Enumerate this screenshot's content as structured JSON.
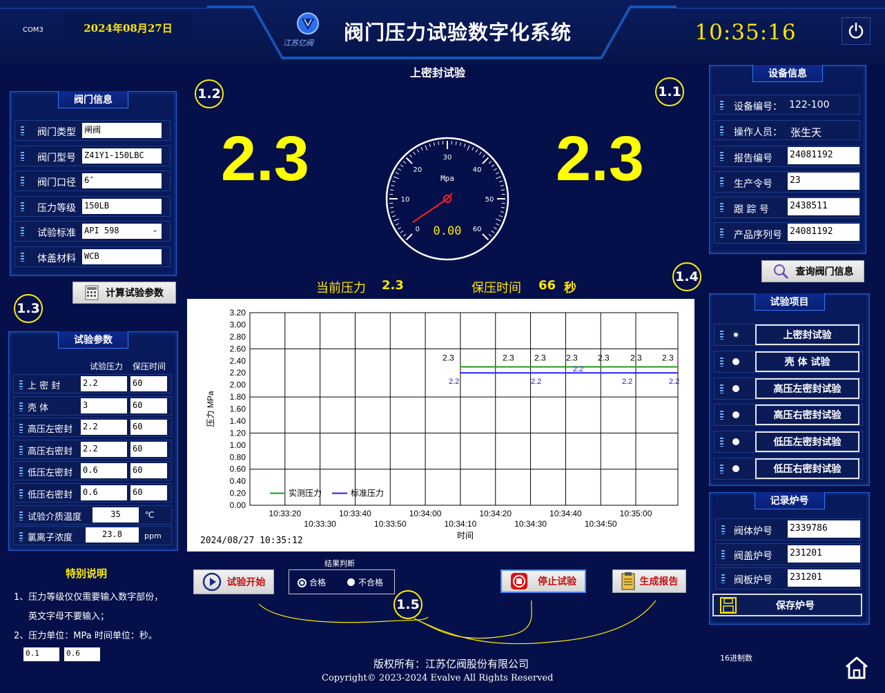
{
  "header": {
    "com_port": "COM3",
    "date": "2024年08月27日",
    "app_title": "阀门压力试验数字化系统",
    "logo_text": "江苏亿阀",
    "time": "10:35:16"
  },
  "test_title": "上密封试验",
  "valve_info": {
    "title": "阀门信息",
    "fields": [
      {
        "label": "阀门类型",
        "value": "闸阀"
      },
      {
        "label": "阀门型号",
        "value": "Z41Y1-150LBC"
      },
      {
        "label": "阀门口径",
        "value": "6″"
      },
      {
        "label": "压力等级",
        "value": "150LB"
      },
      {
        "label": "试验标准",
        "value": "API 598"
      },
      {
        "label": "体盖材料",
        "value": "WCB"
      }
    ],
    "calc_button": "计算试验参数"
  },
  "test_params": {
    "title": "试验参数",
    "col_pressure": "试验压力",
    "col_hold": "保压时间",
    "rows": [
      {
        "label": "上 密 封",
        "pressure": "2.2",
        "hold": "60"
      },
      {
        "label": "壳  体",
        "pressure": "3",
        "hold": "60"
      },
      {
        "label": "高压左密封",
        "pressure": "2.2",
        "hold": "60"
      },
      {
        "label": "高压右密封",
        "pressure": "2.2",
        "hold": "60"
      },
      {
        "label": "低压左密封",
        "pressure": "0.6",
        "hold": "60"
      },
      {
        "label": "低压右密封",
        "pressure": "0.6",
        "hold": "60"
      }
    ],
    "temp_label": "试验介质温度",
    "temp_value": "35",
    "temp_unit": "℃",
    "chloride_label": "氯离子浓度",
    "chloride_value": "23.8",
    "chloride_unit": "ppm"
  },
  "notes": {
    "title": "特别说明",
    "line1": "1、压力等级仅仅需要输入数字部份，",
    "line2": "英文字母不要输入；",
    "line3": "2、压力单位：MPa 时间单位：秒。",
    "box1": "0.1",
    "box2": "0.6"
  },
  "markers": {
    "m11": "1.1",
    "m12": "1.2",
    "m13": "1.3",
    "m14": "1.4",
    "m15": "1.5"
  },
  "readings": {
    "left_value": "2.3",
    "right_value": "2.3",
    "gauge_unit": "Mpa",
    "gauge_readout": "0.00",
    "gauge_ticks": [
      "0",
      "10",
      "20",
      "30",
      "40",
      "50",
      "60"
    ],
    "current_label": "当前压力",
    "current_value": "2.3",
    "hold_label": "保压时间",
    "hold_value": "66",
    "hold_unit": "秒"
  },
  "chart_data": {
    "type": "line",
    "ylabel": "压力 MPa",
    "xlabel": "时间",
    "ylim": [
      0,
      3.2
    ],
    "yticks": [
      "0.00",
      "0.20",
      "0.40",
      "0.60",
      "0.80",
      "1.00",
      "1.20",
      "1.40",
      "1.60",
      "1.80",
      "2.00",
      "2.20",
      "2.40",
      "2.60",
      "2.80",
      "3.00",
      "3.20"
    ],
    "xticks_upper": [
      "10:33:20",
      "10:33:40",
      "10:34:00",
      "10:34:20",
      "10:34:40",
      "10:35:00"
    ],
    "xticks_lower": [
      "10:33:30",
      "10:33:50",
      "10:34:10",
      "10:34:30",
      "10:34:50"
    ],
    "series": [
      {
        "name": "实测压力",
        "color": "#1a9a1a",
        "x_start": "10:34:10",
        "x_end": "10:35:12",
        "y": 2.3
      },
      {
        "name": "标准压力",
        "color": "#2020ff",
        "x_start": "10:34:10",
        "x_end": "10:35:12",
        "y": 2.2
      }
    ],
    "labels_actual": [
      "2.3",
      "2.3",
      "2.3",
      "2.3",
      "2.3",
      "2.3",
      "2.3"
    ],
    "labels_std": [
      "2.2",
      "2.2",
      "2.2",
      "2.2",
      "2.2"
    ],
    "timestamp": "2024/08/27 10:35:12",
    "grid": true,
    "legend": "bottom-left"
  },
  "controls": {
    "start_button": "试验开始",
    "result_title": "结果判断",
    "pass_label": "合格",
    "fail_label": "不合格",
    "stop_button": "停止试验",
    "report_button": "生成报告"
  },
  "device_info": {
    "title": "设备信息",
    "device_no_label": "设备编号：",
    "device_no": "122-100",
    "operator_label": "操作人员：",
    "operator": "张生天",
    "fields": [
      {
        "label": "报告编号",
        "value": "24081192"
      },
      {
        "label": "生产令号",
        "value": "23"
      },
      {
        "label": "跟 踪 号",
        "value": "2438511"
      },
      {
        "label": "产品序列号",
        "value": "24081192"
      }
    ],
    "query_button": "查询阀门信息"
  },
  "test_items": {
    "title": "试验项目",
    "items": [
      "上密封试验",
      "壳  体  试验",
      "高压左密封试验",
      "高压右密封试验",
      "低压左密封试验",
      "低压右密封试验"
    ]
  },
  "furnace": {
    "title": "记录炉号",
    "fields": [
      {
        "label": "阀体炉号",
        "value": "2339786"
      },
      {
        "label": "阀盖炉号",
        "value": "231201"
      },
      {
        "label": "阀板炉号",
        "value": "231201"
      }
    ],
    "save_button": "保存炉号"
  },
  "footer": {
    "copyright_cn": "版权所有：江苏亿阀股份有限公司",
    "copyright_en": "Copyright© 2023-2024 Evalve All Rights Reserved",
    "hex_label": "16进制数"
  }
}
